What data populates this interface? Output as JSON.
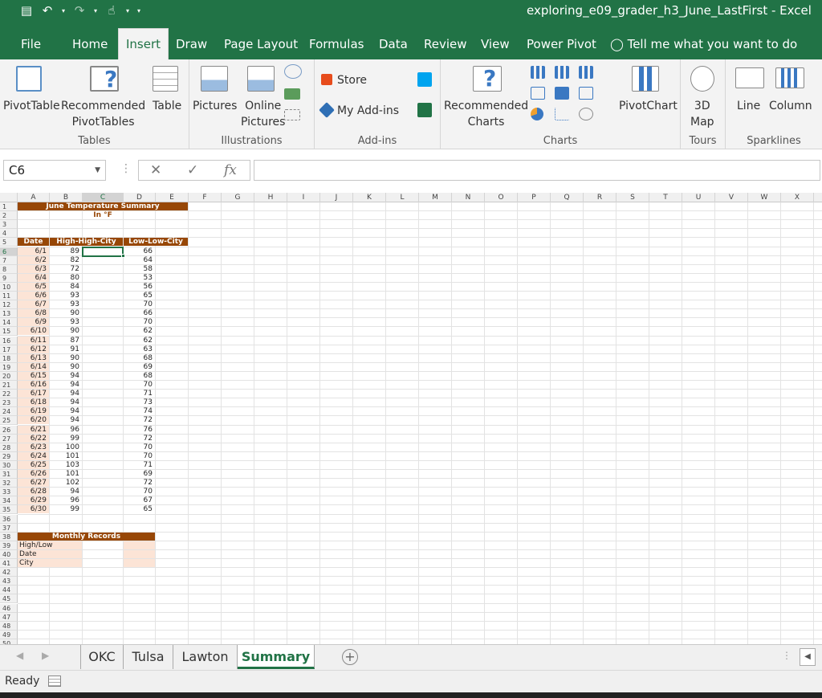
{
  "app": {
    "title": "exploring_e09_grader_h3_June_LastFirst  -  Excel"
  },
  "tabs": [
    {
      "label": "File"
    },
    {
      "label": "Home"
    },
    {
      "label": "Insert"
    },
    {
      "label": "Draw"
    },
    {
      "label": "Page Layout"
    },
    {
      "label": "Formulas"
    },
    {
      "label": "Data"
    },
    {
      "label": "Review"
    },
    {
      "label": "View"
    },
    {
      "label": "Power Pivot"
    }
  ],
  "tellme": "Tell me what you want to do",
  "ribbon": {
    "tables": {
      "label": "Tables",
      "pivottable": "PivotTable",
      "recommended1": "Recommended",
      "recommended2": "PivotTables",
      "table": "Table"
    },
    "illustrations": {
      "label": "Illustrations",
      "pictures": "Pictures",
      "online1": "Online",
      "online2": "Pictures"
    },
    "addins": {
      "label": "Add-ins",
      "store": "Store",
      "myaddins": "My Add-ins"
    },
    "charts": {
      "label": "Charts",
      "rec1": "Recommended",
      "rec2": "Charts",
      "pivotchart": "PivotChart"
    },
    "tours": {
      "label": "Tours",
      "map1": "3D",
      "map2": "Map"
    },
    "sparklines": {
      "label": "Sparklines",
      "line": "Line",
      "column": "Column"
    }
  },
  "formula_bar": {
    "name_box": "C6",
    "fx": "fx",
    "content": ""
  },
  "columns": [
    "A",
    "B",
    "C",
    "D",
    "E",
    "F",
    "G",
    "H",
    "I",
    "J",
    "K",
    "L",
    "M",
    "N",
    "O",
    "P",
    "Q",
    "R",
    "S",
    "T",
    "U",
    "V",
    "W",
    "X"
  ],
  "sheet": {
    "title": "June Temperature Summary",
    "subtitle": "In °F",
    "headers": {
      "date": "Date",
      "high": "High-High-City",
      "low": "Low-Low-City"
    },
    "rows": [
      {
        "date": "6/1",
        "high": "89",
        "low": "66"
      },
      {
        "date": "6/2",
        "high": "82",
        "low": "64"
      },
      {
        "date": "6/3",
        "high": "72",
        "low": "58"
      },
      {
        "date": "6/4",
        "high": "80",
        "low": "53"
      },
      {
        "date": "6/5",
        "high": "84",
        "low": "56"
      },
      {
        "date": "6/6",
        "high": "93",
        "low": "65"
      },
      {
        "date": "6/7",
        "high": "93",
        "low": "70"
      },
      {
        "date": "6/8",
        "high": "90",
        "low": "66"
      },
      {
        "date": "6/9",
        "high": "93",
        "low": "70"
      },
      {
        "date": "6/10",
        "high": "90",
        "low": "62"
      },
      {
        "date": "6/11",
        "high": "87",
        "low": "62"
      },
      {
        "date": "6/12",
        "high": "91",
        "low": "63"
      },
      {
        "date": "6/13",
        "high": "90",
        "low": "68"
      },
      {
        "date": "6/14",
        "high": "90",
        "low": "69"
      },
      {
        "date": "6/15",
        "high": "94",
        "low": "68"
      },
      {
        "date": "6/16",
        "high": "94",
        "low": "70"
      },
      {
        "date": "6/17",
        "high": "94",
        "low": "71"
      },
      {
        "date": "6/18",
        "high": "94",
        "low": "73"
      },
      {
        "date": "6/19",
        "high": "94",
        "low": "74"
      },
      {
        "date": "6/20",
        "high": "94",
        "low": "72"
      },
      {
        "date": "6/21",
        "high": "96",
        "low": "76"
      },
      {
        "date": "6/22",
        "high": "99",
        "low": "72"
      },
      {
        "date": "6/23",
        "high": "100",
        "low": "70"
      },
      {
        "date": "6/24",
        "high": "101",
        "low": "70"
      },
      {
        "date": "6/25",
        "high": "103",
        "low": "71"
      },
      {
        "date": "6/26",
        "high": "101",
        "low": "69"
      },
      {
        "date": "6/27",
        "high": "102",
        "low": "72"
      },
      {
        "date": "6/28",
        "high": "94",
        "low": "70"
      },
      {
        "date": "6/29",
        "high": "96",
        "low": "67"
      },
      {
        "date": "6/30",
        "high": "99",
        "low": "65"
      }
    ],
    "records_title": "Monthly Records",
    "records_labels": [
      "High/Low",
      "Date",
      "City"
    ]
  },
  "sheet_tabs": [
    {
      "label": "OKC"
    },
    {
      "label": "Tulsa"
    },
    {
      "label": "Lawton"
    },
    {
      "label": "Summary"
    }
  ],
  "status": "Ready",
  "colors": {
    "excel_green": "#217346",
    "header_brown": "#974706",
    "peach": "#fce4d6"
  }
}
